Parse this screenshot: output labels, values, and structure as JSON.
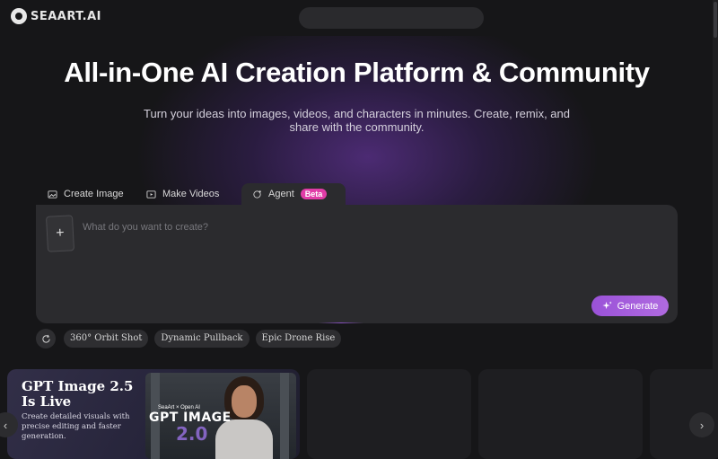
{
  "header": {
    "logo_text": "SEAART.AI",
    "search_placeholder": ""
  },
  "hero": {
    "title": "All-in-One AI Creation Platform & Community",
    "subtitle": "Turn your ideas into images, videos, and characters in minutes. Create, remix, and share with the community."
  },
  "tabs": [
    {
      "label": "Create Image",
      "icon": "image-icon"
    },
    {
      "label": "Make Videos",
      "icon": "video-icon"
    },
    {
      "label": "Agent",
      "icon": "agent-icon",
      "badge": "Beta"
    }
  ],
  "prompt": {
    "placeholder": "What do you want to create?",
    "add_label": "+",
    "generate_label": "Generate"
  },
  "suggestions": [
    "360° Orbit Shot",
    "Dynamic Pullback",
    "Epic Drone Rise"
  ],
  "featured": {
    "title": "GPT Image 2.5 Is Live",
    "description": "Create detailed visuals with precise editing and faster generation.",
    "image_brand": "SeaArt × Open AI",
    "image_title": "GPT IMAGE",
    "image_number": "2.0"
  },
  "colors": {
    "background": "#161618",
    "panel": "#2b2b2e",
    "accent": "#a45cdc",
    "beta_badge": "#e13ca7"
  }
}
